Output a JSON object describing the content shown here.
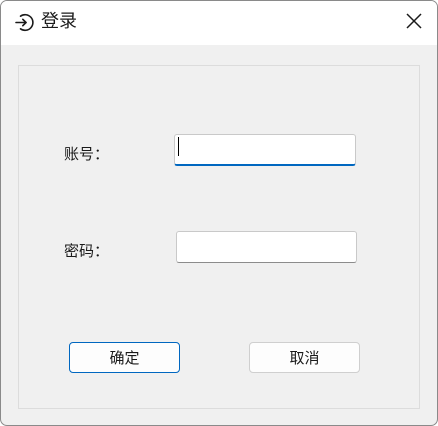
{
  "window": {
    "title": "登录",
    "title_icon": "login-icon",
    "close_icon": "close-icon"
  },
  "form": {
    "account_label": "账号：",
    "account_value": "",
    "password_label": "密码：",
    "password_value": ""
  },
  "buttons": {
    "confirm_label": "确定",
    "cancel_label": "取消"
  },
  "colors": {
    "accent": "#0067c0",
    "window_bg": "#f0f0f0",
    "titlebar_bg": "#ffffff"
  }
}
